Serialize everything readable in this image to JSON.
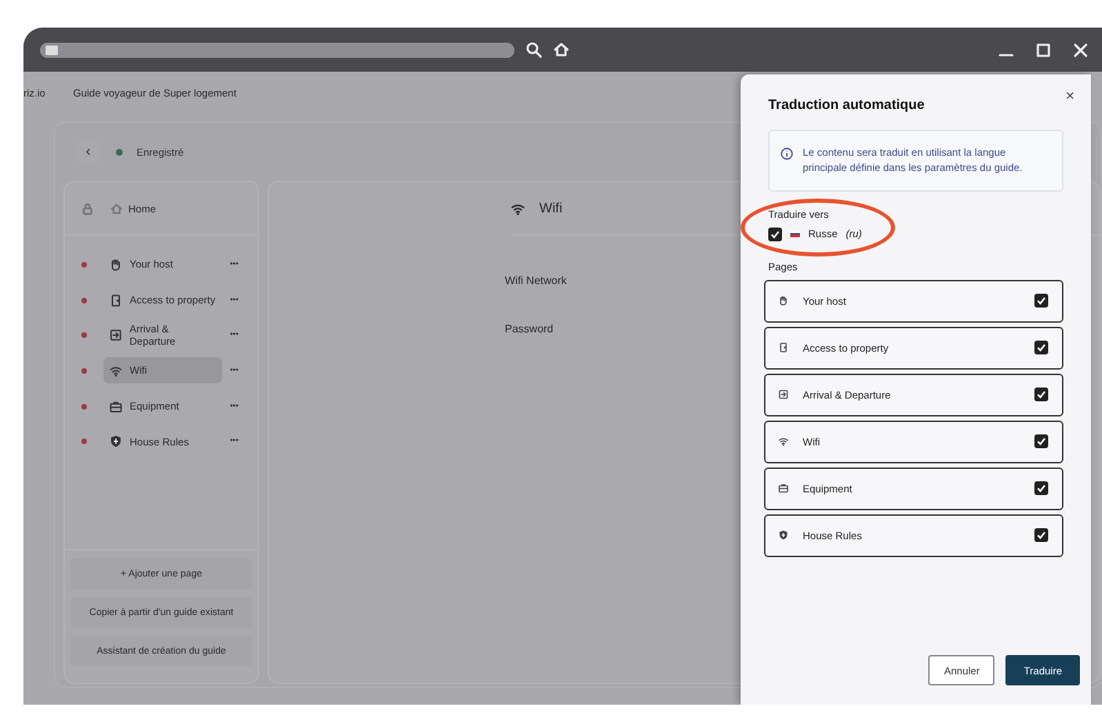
{
  "header": {
    "brand": "riz.io",
    "title": "Guide voyageur de Super logement"
  },
  "editor": {
    "back": "‹",
    "save_status": "Enregistré"
  },
  "sidebar": {
    "home": "Home",
    "pages": [
      {
        "label": "Your host",
        "selected": false
      },
      {
        "label": "Access to property",
        "selected": false
      },
      {
        "label": "Arrival & Departure",
        "selected": false
      },
      {
        "label": "Wifi",
        "selected": true
      },
      {
        "label": "Equipment",
        "selected": false
      },
      {
        "label": "House Rules",
        "selected": false
      }
    ],
    "more": "•••",
    "actions": [
      "+ Ajouter une page",
      "Copier à partir d'un guide existant",
      "Assistant de création du guide"
    ]
  },
  "content": {
    "title": "Wifi",
    "fields": [
      "Wifi Network",
      "Password"
    ]
  },
  "dialog": {
    "title": "Traduction automatique",
    "close": "×",
    "info": "Le contenu sera traduit en utilisant la langue principale définie dans les paramètres du guide.",
    "target_label": "Traduire vers",
    "language": {
      "name": "Russe",
      "code": "(ru)",
      "checked": true
    },
    "pages_label": "Pages",
    "pages": [
      {
        "label": "Your host",
        "checked": true
      },
      {
        "label": "Access to property",
        "checked": true
      },
      {
        "label": "Arrival & Departure",
        "checked": true
      },
      {
        "label": "Wifi",
        "checked": true
      },
      {
        "label": "Equipment",
        "checked": true
      },
      {
        "label": "House Rules",
        "checked": true
      }
    ],
    "buttons": [
      {
        "label": "Annuler",
        "kind": "secondary"
      },
      {
        "label": "Traduire",
        "kind": "primary"
      }
    ]
  }
}
